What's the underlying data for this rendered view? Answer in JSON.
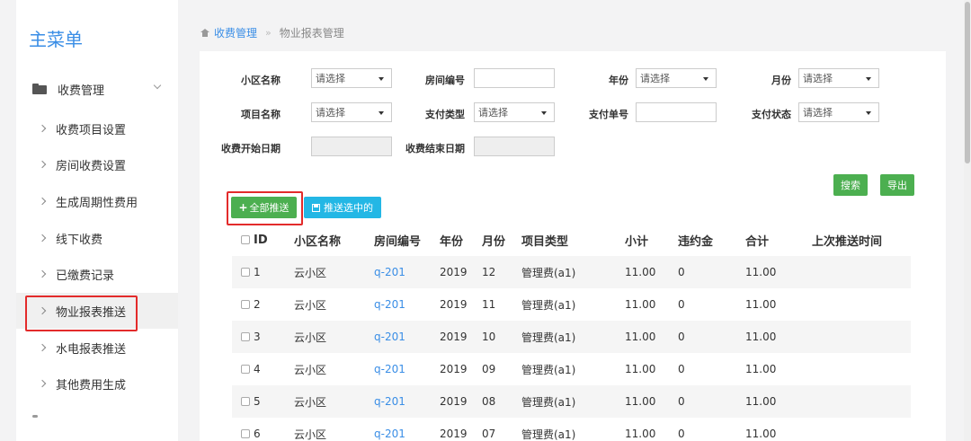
{
  "sidebar": {
    "title": "主菜单",
    "group_label": "收费管理",
    "items": [
      {
        "label": "收费项目设置"
      },
      {
        "label": "房间收费设置"
      },
      {
        "label": "生成周期性费用"
      },
      {
        "label": "线下收费"
      },
      {
        "label": "已缴费记录"
      },
      {
        "label": "物业报表推送",
        "active": true
      },
      {
        "label": "水电报表推送"
      },
      {
        "label": "其他费用生成"
      }
    ]
  },
  "breadcrumb": {
    "parent": "收费管理",
    "separator": "»",
    "current": "物业报表管理"
  },
  "filters": {
    "community_label": "小区名称",
    "community_value": "请选择",
    "room_label": "房间编号",
    "room_value": "",
    "year_label": "年份",
    "year_value": "请选择",
    "month_label": "月份",
    "month_value": "请选择",
    "item_label": "项目名称",
    "item_value": "请选择",
    "paytype_label": "支付类型",
    "paytype_value": "请选择",
    "payno_label": "支付单号",
    "payno_value": "",
    "paystatus_label": "支付状态",
    "paystatus_value": "请选择",
    "start_label": "收费开始日期",
    "end_label": "收费结束日期"
  },
  "buttons": {
    "search": "搜索",
    "export": "导出",
    "push_all": "全部推送",
    "push_selected": "推送选中的"
  },
  "table": {
    "headers": [
      "ID",
      "小区名称",
      "房间编号",
      "年份",
      "月份",
      "项目类型",
      "小计",
      "违约金",
      "合计",
      "上次推送时间"
    ],
    "rows": [
      {
        "id": "1",
        "community": "云小区",
        "room": "q-201",
        "year": "2019",
        "month": "12",
        "type": "管理费(a1)",
        "subtotal": "11.00",
        "penalty": "0",
        "total": "11.00",
        "last_push": ""
      },
      {
        "id": "2",
        "community": "云小区",
        "room": "q-201",
        "year": "2019",
        "month": "11",
        "type": "管理费(a1)",
        "subtotal": "11.00",
        "penalty": "0",
        "total": "11.00",
        "last_push": ""
      },
      {
        "id": "3",
        "community": "云小区",
        "room": "q-201",
        "year": "2019",
        "month": "10",
        "type": "管理费(a1)",
        "subtotal": "11.00",
        "penalty": "0",
        "total": "11.00",
        "last_push": ""
      },
      {
        "id": "4",
        "community": "云小区",
        "room": "q-201",
        "year": "2019",
        "month": "09",
        "type": "管理费(a1)",
        "subtotal": "11.00",
        "penalty": "0",
        "total": "11.00",
        "last_push": ""
      },
      {
        "id": "5",
        "community": "云小区",
        "room": "q-201",
        "year": "2019",
        "month": "08",
        "type": "管理费(a1)",
        "subtotal": "11.00",
        "penalty": "0",
        "total": "11.00",
        "last_push": ""
      },
      {
        "id": "6",
        "community": "云小区",
        "room": "q-201",
        "year": "2019",
        "month": "07",
        "type": "管理费(a1)",
        "subtotal": "11.00",
        "penalty": "0",
        "total": "11.00",
        "last_push": ""
      }
    ]
  }
}
